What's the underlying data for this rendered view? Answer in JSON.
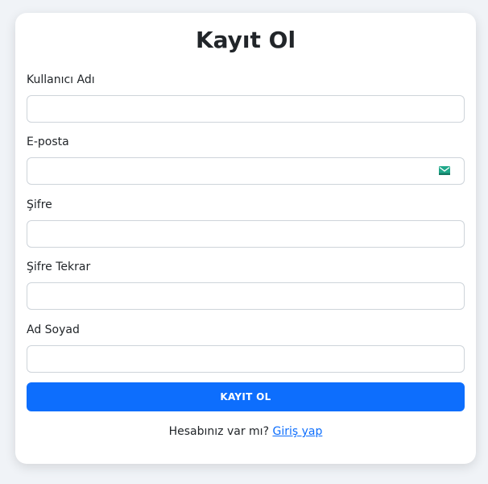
{
  "form": {
    "title": "Kayıt Ol",
    "fields": [
      {
        "label": "Kullanıcı Adı",
        "value": "",
        "placeholder": ""
      },
      {
        "label": "E-posta",
        "value": "",
        "placeholder": "",
        "icon": "email-icon"
      },
      {
        "label": "Şifre",
        "value": "",
        "placeholder": ""
      },
      {
        "label": "Şifre Tekrar",
        "value": "",
        "placeholder": ""
      },
      {
        "label": "Ad Soyad",
        "value": "",
        "placeholder": ""
      }
    ],
    "submit_label": "KAYIT OL",
    "footer_text": "Hesabınız var mı?",
    "login_link": "Giriş yap"
  },
  "colors": {
    "accent": "#0d6efd",
    "background": "#f0f3f7",
    "card": "#ffffff",
    "border": "#ced4da",
    "email_icon": "#20a88a"
  }
}
